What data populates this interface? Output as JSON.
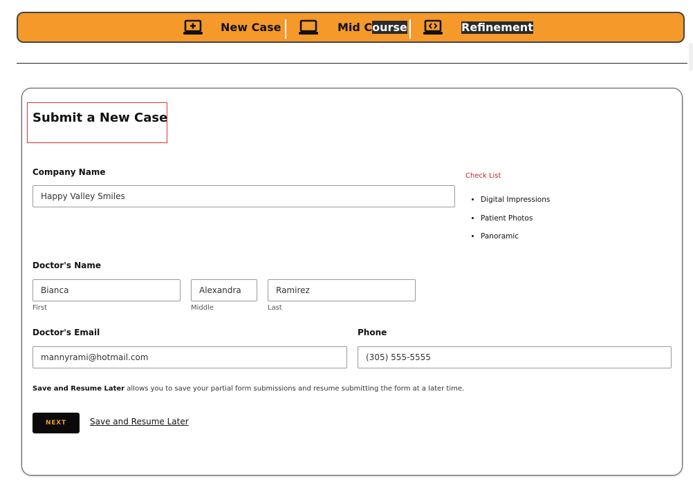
{
  "nav": {
    "items": [
      {
        "icon": "laptop-plus-icon",
        "label": "New Case"
      },
      {
        "icon": "laptop-icon",
        "label_a": "Mid C",
        "label_b": "ourse"
      },
      {
        "icon": "laptop-code-icon",
        "label": "Refinement"
      }
    ]
  },
  "form": {
    "title": "Submit a New Case",
    "company_label": "Company Name",
    "company_value": "Happy Valley Smiles",
    "doctor_label": "Doctor's Name",
    "first_value": "Bianca",
    "first_sub": "First",
    "middle_value": "Alexandra",
    "middle_sub": "Middle",
    "last_value": "Ramirez",
    "last_sub": "Last",
    "email_label": "Doctor's Email",
    "email_value": "mannyrami@hotmail.com",
    "phone_label": "Phone",
    "phone_value": "(305) 555-5555",
    "note_bold": "Save and Resume Later",
    "note_rest": " allows you to save your partial form submissions and resume submitting the form at a later time.",
    "next_label": "NEXT",
    "resume_label": "Save and Resume Later"
  },
  "checklist": {
    "title": "Check List",
    "items": [
      "Digital Impressions",
      "Patient Photos",
      "Panoramic"
    ]
  },
  "colors": {
    "accent": "#f5992a",
    "title_box": "#dd3333",
    "checklist_title": "#cc1f1f"
  }
}
